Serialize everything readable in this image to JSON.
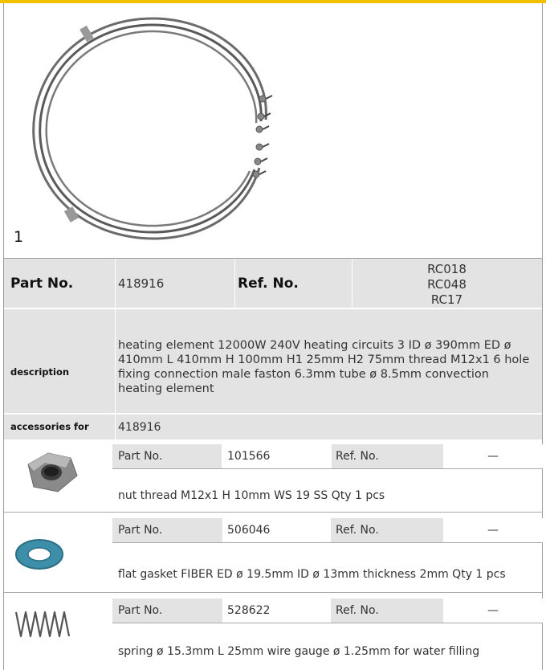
{
  "image_number": "1",
  "part": {
    "part_no_label": "Part No.",
    "part_no": "418916",
    "ref_no_label": "Ref. No.",
    "ref_nos": [
      "RC018",
      "RC048",
      "RC17"
    ]
  },
  "description": {
    "label": "description",
    "text": "heating element  12000W 240V heating circuits 3 ID ø 390mm ED ø 410mm L 410mm H 100mm H1 25mm H2 75mm thread M12x1 6 hole fixing connection male faston 6.3mm tube ø 8.5mm convection heating element"
  },
  "accessories": {
    "label": "accessories for",
    "value": "418916",
    "items": [
      {
        "icon": "hex-nut-icon",
        "part_no_label": "Part No.",
        "part_no": "101566",
        "ref_no_label": "Ref. No.",
        "ref_no": "—",
        "text": "nut  thread M12x1 H 10mm WS 19 SS Qty 1 pcs"
      },
      {
        "icon": "flat-gasket-icon",
        "part_no_label": "Part No.",
        "part_no": "506046",
        "ref_no_label": "Ref. No.",
        "ref_no": "—",
        "text": "flat gasket  FIBER ED ø 19.5mm ID ø 13mm thickness 2mm Qty 1 pcs"
      },
      {
        "icon": "spring-icon",
        "part_no_label": "Part No.",
        "part_no": "528622",
        "ref_no_label": "Ref. No.",
        "ref_no": "—",
        "text": "spring  ø 15.3mm L 25mm wire gauge ø 1.25mm for water filling"
      }
    ]
  },
  "colors": {
    "accent": "#f2c200",
    "label_bg": "#e3e3e3",
    "border": "#a9a9a9"
  }
}
